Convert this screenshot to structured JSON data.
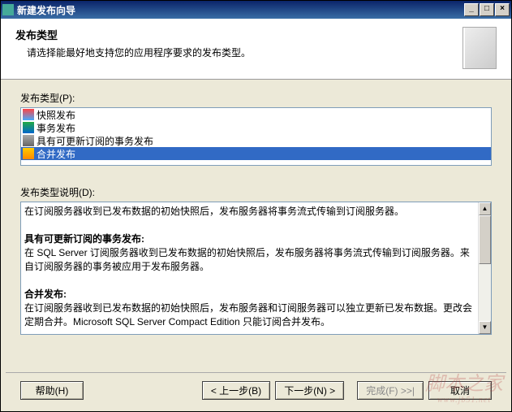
{
  "titlebar": {
    "icon": "wizard-icon",
    "title": "新建发布向导"
  },
  "header": {
    "title": "发布类型",
    "subtitle": "请选择能最好地支持您的应用程序要求的发布类型。"
  },
  "listLabel": "发布类型(P):",
  "listItems": [
    {
      "label": "快照发布",
      "selected": false
    },
    {
      "label": "事务发布",
      "selected": false
    },
    {
      "label": "具有可更新订阅的事务发布",
      "selected": false
    },
    {
      "label": "合并发布",
      "selected": true
    }
  ],
  "descLabel": "发布类型说明(D):",
  "description": {
    "line1": "在订阅服务器收到已发布数据的初始快照后，发布服务器将事务流式传输到订阅服务器。",
    "heading2": "具有可更新订阅的事务发布:",
    "line2": "在 SQL Server 订阅服务器收到已发布数据的初始快照后，发布服务器将事务流式传输到订阅服务器。来自订阅服务器的事务被应用于发布服务器。",
    "heading3": "合并发布:",
    "line3": "在订阅服务器收到已发布数据的初始快照后，发布服务器和订阅服务器可以独立更新已发布数据。更改会定期合并。Microsoft SQL Server Compact Edition 只能订阅合并发布。"
  },
  "buttons": {
    "help": "帮助(H)",
    "back": "< 上一步(B)",
    "next": "下一步(N) >",
    "finish": "完成(F) >>|",
    "cancel": "取消"
  },
  "watermark": {
    "text": "脚本之家",
    "url": "www.jb51.net"
  }
}
